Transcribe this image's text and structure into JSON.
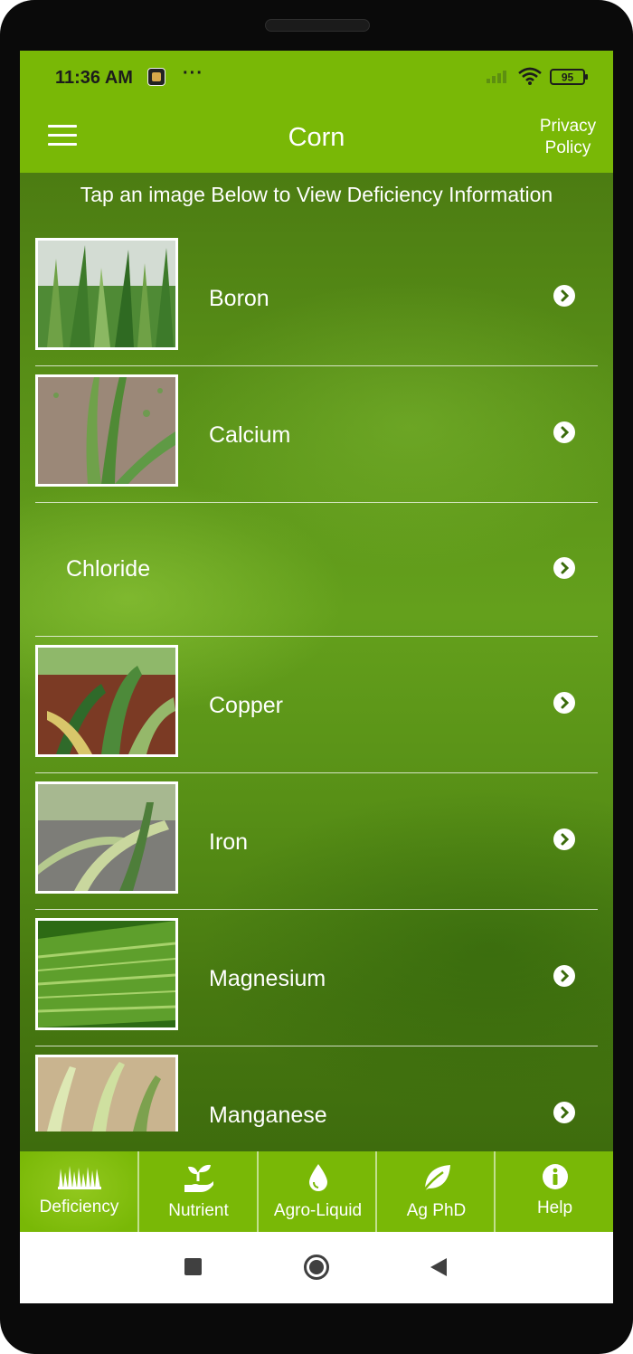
{
  "status_bar": {
    "time": "11:36 AM",
    "dots": "···",
    "battery": "95"
  },
  "app_bar": {
    "title": "Corn",
    "privacy_link": "Privacy Policy"
  },
  "instruction": "Tap an image Below to View Deficiency Information",
  "deficiencies": [
    {
      "label": "Boron",
      "has_image": true,
      "image_colors": [
        "#cfd8cf",
        "#3d7a2a",
        "#6fa146"
      ]
    },
    {
      "label": "Calcium",
      "has_image": true,
      "image_colors": [
        "#9b8878",
        "#5f9a45",
        "#c8b9a4"
      ]
    },
    {
      "label": "Chloride",
      "has_image": false
    },
    {
      "label": "Copper",
      "has_image": true,
      "image_colors": [
        "#7b3a24",
        "#2f6a2a",
        "#95b86a"
      ]
    },
    {
      "label": "Iron",
      "has_image": true,
      "image_colors": [
        "#7d7d78",
        "#b5c98e",
        "#4e7e3a"
      ]
    },
    {
      "label": "Magnesium",
      "has_image": true,
      "image_colors": [
        "#2d6a14",
        "#7cb53c",
        "#a7d26a"
      ]
    },
    {
      "label": "Manganese",
      "has_image": true,
      "image_colors": [
        "#c9b48f",
        "#dde8b4",
        "#7ca14e"
      ]
    }
  ],
  "tabs": [
    {
      "label": "Deficiency",
      "icon": "grass-icon",
      "active": true
    },
    {
      "label": "Nutrient",
      "icon": "seedling-hand-icon",
      "active": false
    },
    {
      "label": "Agro-Liquid",
      "icon": "droplet-icon",
      "active": false
    },
    {
      "label": "Ag PhD",
      "icon": "leaf-icon",
      "active": false
    },
    {
      "label": "Help",
      "icon": "info-icon",
      "active": false
    }
  ],
  "colors": {
    "brand_green": "#79b806",
    "content_dark_green": "#4c7c12",
    "nav_gray": "#404040"
  }
}
